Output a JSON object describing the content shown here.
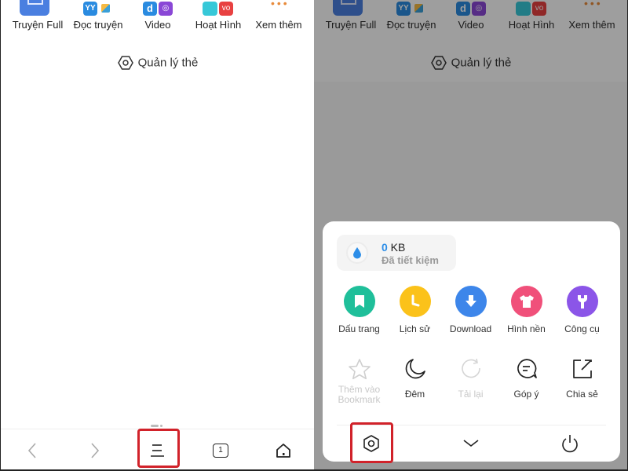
{
  "shortcuts": [
    {
      "label": "Truyện Full",
      "icon": "book-icon"
    },
    {
      "label": "Đọc truyện",
      "icon": "yy-icon",
      "badge": "YY"
    },
    {
      "label": "Video",
      "icon": "video-icon",
      "badge": "d"
    },
    {
      "label": "Hoạt Hình",
      "icon": "cartoon-icon",
      "badge": "vo"
    },
    {
      "label": "Xem thêm",
      "icon": "more-icon"
    }
  ],
  "manage_tabs": {
    "label": "Quản lý thẻ",
    "icon": "hexagon-settings-icon"
  },
  "bottom_nav": {
    "back_icon": "chevron-left-icon",
    "forward_icon": "chevron-right-icon",
    "menu_icon": "menu-icon",
    "tabs_icon": "tabs-icon",
    "tabs_count": "1",
    "home_icon": "home-icon"
  },
  "menu": {
    "saved": {
      "value": "0",
      "unit": " KB",
      "label": "Đã tiết kiệm",
      "icon": "water-drop-icon"
    },
    "primary_items": [
      {
        "label": "Dấu trang",
        "icon": "bookmark-icon",
        "color": "#1fbf9a"
      },
      {
        "label": "Lịch sử",
        "icon": "clock-icon",
        "color": "#fbc21a"
      },
      {
        "label": "Download",
        "icon": "download-icon",
        "color": "#3d86ea"
      },
      {
        "label": "Hình nền",
        "icon": "shirt-icon",
        "color": "#f0507a"
      },
      {
        "label": "Công cụ",
        "icon": "wrench-icon",
        "color": "#8b55e8"
      }
    ],
    "secondary_items": [
      {
        "label": "Thêm vào Bookmark",
        "icon": "star-icon",
        "disabled": true
      },
      {
        "label": "Đêm",
        "icon": "moon-icon",
        "disabled": false
      },
      {
        "label": "Tải lại",
        "icon": "reload-icon",
        "disabled": true
      },
      {
        "label": "Góp ý",
        "icon": "feedback-icon",
        "disabled": false
      },
      {
        "label": "Chia sẻ",
        "icon": "share-icon",
        "disabled": false
      }
    ],
    "footer": {
      "settings_icon": "settings-icon",
      "collapse_icon": "chevron-down-icon",
      "exit_icon": "power-icon"
    }
  },
  "highlight_color": "#d1222a"
}
